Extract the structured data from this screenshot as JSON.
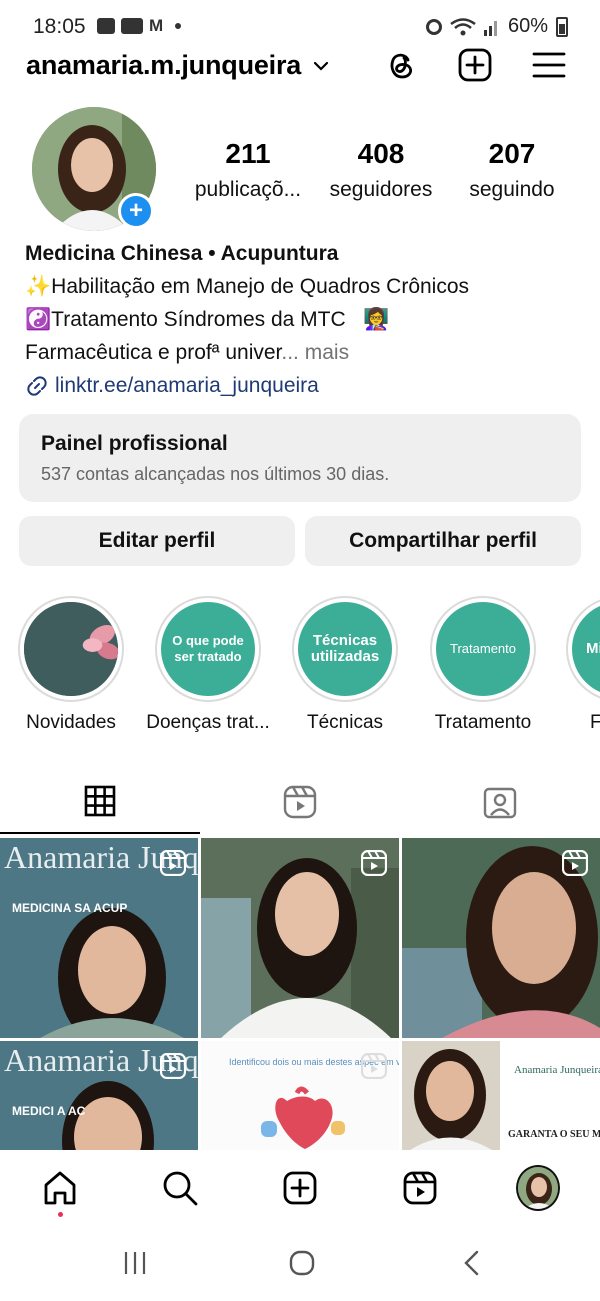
{
  "status_bar": {
    "time": "18:05",
    "battery": "60%",
    "notification_icons": [
      "gallery-icon",
      "youtube-icon",
      "gmail-icon"
    ]
  },
  "header": {
    "username": "anamaria.m.junqueira"
  },
  "profile": {
    "stats": [
      {
        "value": "211",
        "label": "publicaçõ..."
      },
      {
        "value": "408",
        "label": "seguidores"
      },
      {
        "value": "207",
        "label": "seguindo"
      }
    ],
    "bio": {
      "name": "Medicina Chinesa • Acupuntura",
      "line1": "✨Habilitação em Manejo de Quadros Crônicos",
      "line2": "☯️Tratamento Síndromes da MTC",
      "line2_emoji": "👩‍🏫",
      "line3": "Farmacêutica e profª univer",
      "more": "... mais",
      "link": "linktr.ee/anamaria_junqueira"
    }
  },
  "dashboard": {
    "title": "Painel profissional",
    "subtitle": "537 contas alcançadas nos últimos 30 dias."
  },
  "buttons": {
    "edit": "Editar perfil",
    "share": "Compartilhar perfil"
  },
  "highlights": [
    {
      "label": "Novidades",
      "cover": ""
    },
    {
      "label": "Doenças trat...",
      "cover": "O que pode ser tratado"
    },
    {
      "label": "Técnicas",
      "cover": "Técnicas utilizadas"
    },
    {
      "label": "Tratamento",
      "cover": "Tratamento"
    },
    {
      "label": "For",
      "cover": "Mi for"
    }
  ],
  "posts": [
    {
      "overlay_title": "Anamaria Junqueira",
      "overlay_sub": "MEDICINA SA ACUP"
    },
    {
      "overlay_title": "",
      "overlay_sub": ""
    },
    {
      "overlay_title": "",
      "overlay_sub": ""
    },
    {
      "overlay_title": "Anamaria Junqueira",
      "overlay_sub": "MEDICI A AC"
    },
    {
      "overlay_title": "Identificou dois ou mais destes aspec em você?",
      "overlay_sub": ""
    },
    {
      "overlay_title": "Anamaria Junqueira",
      "overlay_sub": "GARANTA O SEU MOMENTO DE"
    }
  ],
  "colors": {
    "accent_blue": "#1d8ff0",
    "highlight_teal": "#3cae98",
    "link": "#1f3a75",
    "notification_dot": "#ed2e55"
  }
}
